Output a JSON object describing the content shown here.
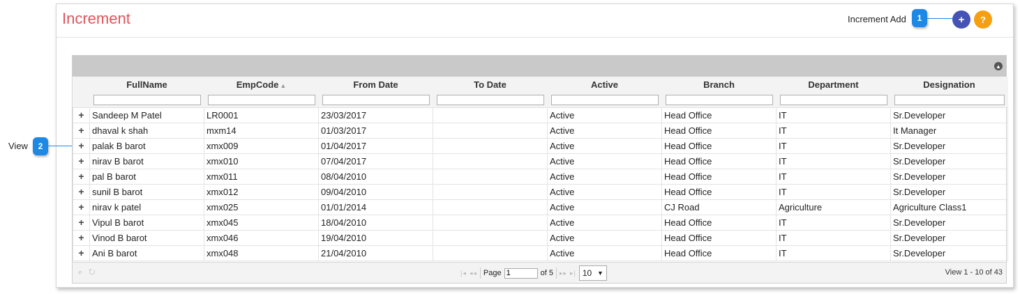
{
  "header": {
    "title": "Increment",
    "add_label": "Increment Add",
    "add_icon": "+",
    "help_icon": "?"
  },
  "callouts": [
    {
      "number": "1",
      "label": ""
    },
    {
      "number": "2",
      "label": "View"
    }
  ],
  "grid": {
    "columns": [
      "FullName",
      "EmpCode",
      "From Date",
      "To Date",
      "Active",
      "Branch",
      "Department",
      "Designation"
    ],
    "expand_icon": "+",
    "rows": [
      [
        "Sandeep M Patel",
        "LR0001",
        "23/03/2017",
        "",
        "Active",
        "Head Office",
        "IT",
        "Sr.Developer"
      ],
      [
        "dhaval k shah",
        "mxm14",
        "01/03/2017",
        "",
        "Active",
        "Head Office",
        "IT",
        "It Manager"
      ],
      [
        "palak B barot",
        "xmx009",
        "01/04/2017",
        "",
        "Active",
        "Head Office",
        "IT",
        "Sr.Developer"
      ],
      [
        "nirav B barot",
        "xmx010",
        "07/04/2017",
        "",
        "Active",
        "Head Office",
        "IT",
        "Sr.Developer"
      ],
      [
        "pal B barot",
        "xmx011",
        "08/04/2010",
        "",
        "Active",
        "Head Office",
        "IT",
        "Sr.Developer"
      ],
      [
        "sunil B barot",
        "xmx012",
        "09/04/2010",
        "",
        "Active",
        "Head Office",
        "IT",
        "Sr.Developer"
      ],
      [
        "nirav k patel",
        "xmx025",
        "01/01/2014",
        "",
        "Active",
        "CJ Road",
        "Agriculture",
        "Agriculture Class1"
      ],
      [
        "Vipul B barot",
        "xmx045",
        "18/04/2010",
        "",
        "Active",
        "Head Office",
        "IT",
        "Sr.Developer"
      ],
      [
        "Vinod B barot",
        "xmx046",
        "19/04/2010",
        "",
        "Active",
        "Head Office",
        "IT",
        "Sr.Developer"
      ],
      [
        "Ani B barot",
        "xmx048",
        "21/04/2010",
        "",
        "Active",
        "Head Office",
        "IT",
        "Sr.Developer"
      ]
    ]
  },
  "pager": {
    "page_label": "Page",
    "page_value": "1",
    "of_label": "of 5",
    "page_size": "10",
    "view_count": "View 1 - 10 of 43"
  },
  "colors": {
    "title": "#e0545b",
    "add_button": "#4552b6",
    "help_button": "#f5a011",
    "callout": "#1e88e5"
  }
}
